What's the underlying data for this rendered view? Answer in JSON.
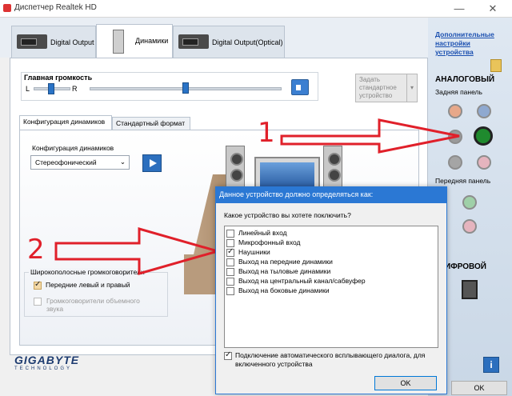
{
  "window": {
    "title": "Диспетчер Realtek HD",
    "minimize": "—",
    "close": "✕"
  },
  "device_tabs": [
    {
      "label": "Digital Output"
    },
    {
      "label": "Динамики"
    },
    {
      "label": "Digital Output(Optical)"
    }
  ],
  "right_panel": {
    "advanced_link": "Дополнительные настройки устройства",
    "analog_heading": "АНАЛОГОВЫЙ",
    "rear_panel_label": "Задняя панель",
    "front_panel_label": "Передняя панель",
    "digital_heading": "ИФРОВОЙ"
  },
  "volume": {
    "title": "Главная громкость",
    "left_label": "L",
    "right_label": "R",
    "default_device_btn": "Задать стандартное устройство"
  },
  "sub_tabs": [
    {
      "label": "Конфигурация динамиков"
    },
    {
      "label": "Стандартный формат"
    }
  ],
  "speaker_config": {
    "label": "Конфигурация динамиков",
    "selected": "Стереофонический",
    "wideband_title": "Широкополосные громкоговорители",
    "front_lr": "Передние левый и правый",
    "surround": "Громкоговорители объемного звука"
  },
  "dialog": {
    "title": "Данное устройство должно определяться как:",
    "question": "Какое устройство вы хотете поключить?",
    "options": [
      {
        "label": "Линейный вход",
        "checked": false
      },
      {
        "label": "Микрофонный вход",
        "checked": false
      },
      {
        "label": "Наушники",
        "checked": true
      },
      {
        "label": "Выход на передние динамики",
        "checked": false
      },
      {
        "label": "Выход на тыловые динамики",
        "checked": false
      },
      {
        "label": "Выход на центральный канал/сабвуфер",
        "checked": false
      },
      {
        "label": "Выход на боковые динамики",
        "checked": false
      }
    ],
    "auto_popup": "Подключение автоматического всплывающего диалога, для включенного устройства",
    "ok_label": "OK"
  },
  "main_ok_label": "OK",
  "annotations": {
    "one": "1",
    "two": "2"
  },
  "brand": {
    "name": "GIGABYTE",
    "sub": "TECHNOLOGY"
  },
  "colors": {
    "accent": "#2b78d4",
    "arrow_red": "#e0202a",
    "green_jack": "#1f8a2e"
  }
}
